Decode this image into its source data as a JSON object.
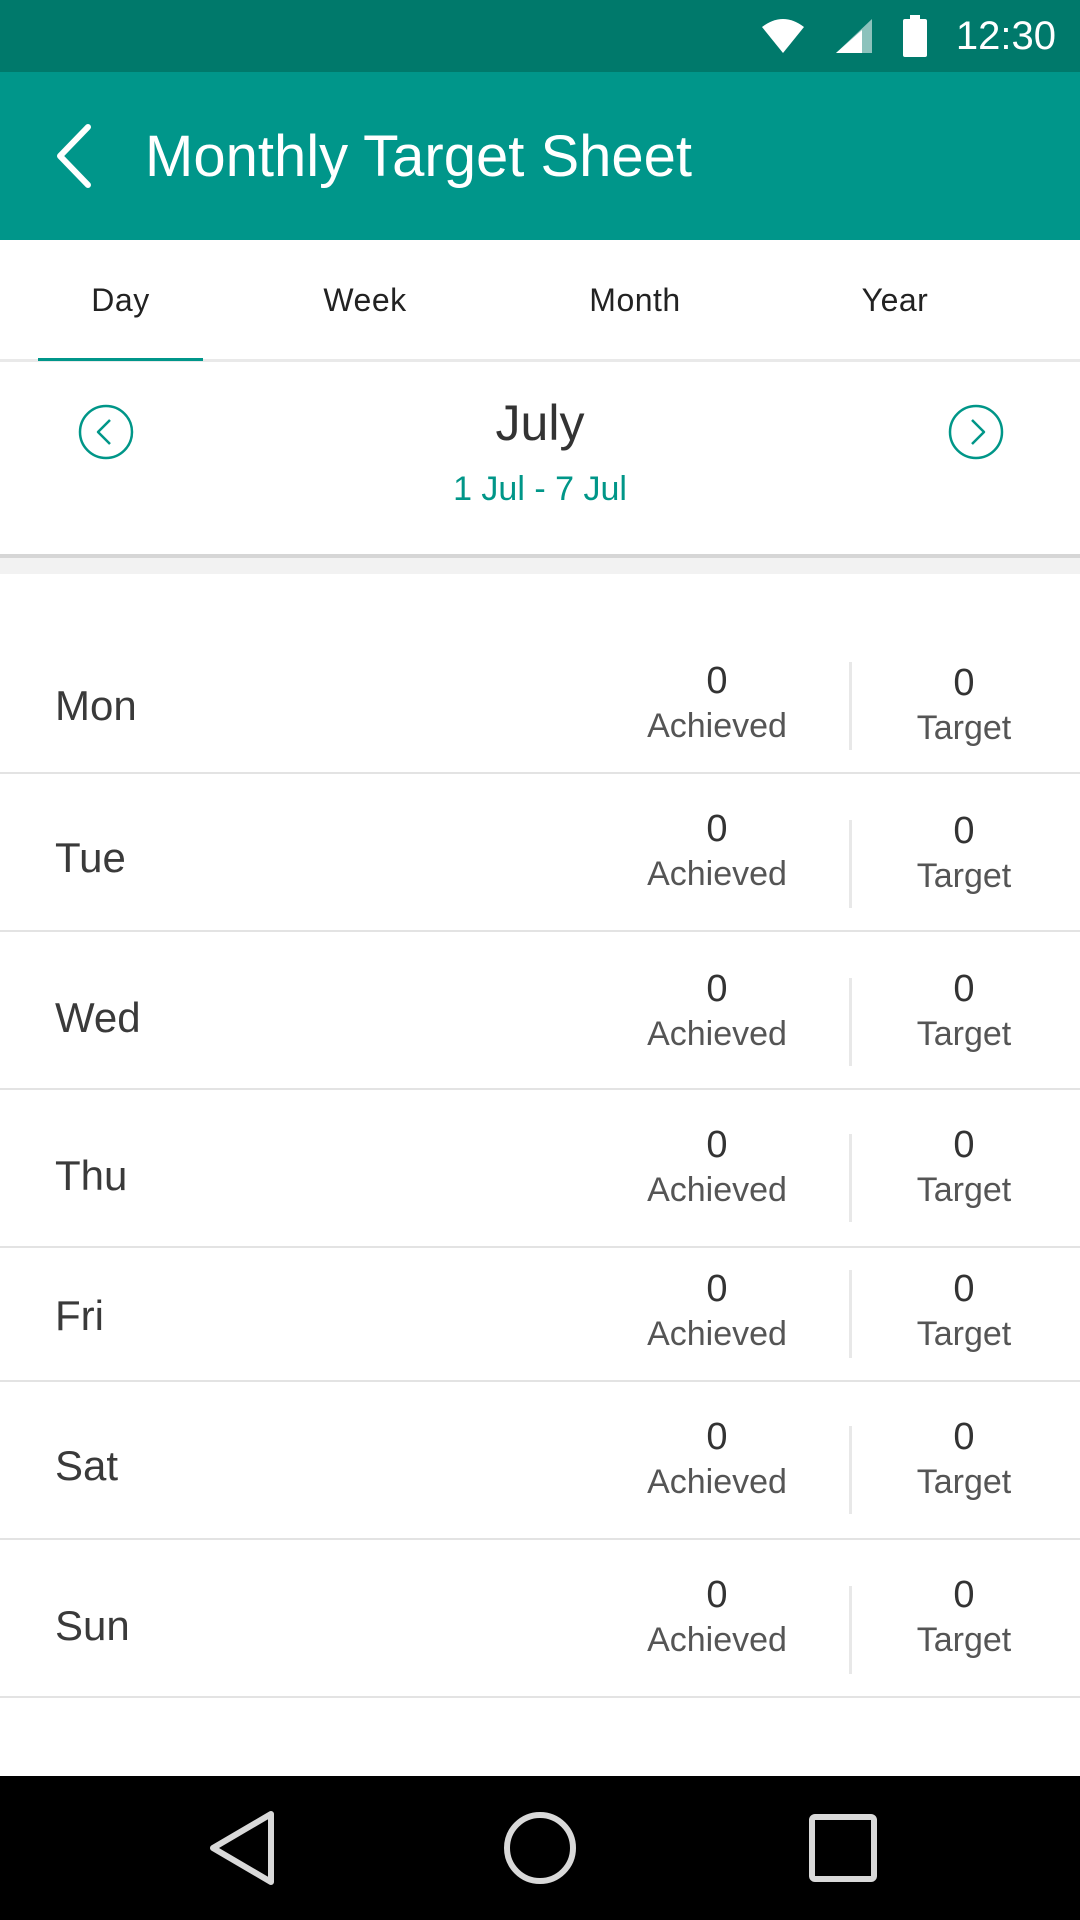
{
  "status_bar": {
    "time": "12:30",
    "icons": [
      "wifi-icon",
      "signal-icon",
      "battery-icon"
    ]
  },
  "app_bar": {
    "title": "Monthly Target Sheet",
    "back_icon": "chevron-left-icon"
  },
  "tabs": [
    {
      "label": "Day",
      "selected": true
    },
    {
      "label": "Week",
      "selected": false
    },
    {
      "label": "Month",
      "selected": false
    },
    {
      "label": "Year",
      "selected": false
    }
  ],
  "period": {
    "month": "July",
    "range": "1 Jul - 7 Jul",
    "prev_icon": "chevron-left-circle-icon",
    "next_icon": "chevron-right-circle-icon"
  },
  "days": [
    {
      "day": "Mon",
      "achieved": "0",
      "achieved_label": "Achieved",
      "target": "0",
      "target_label": "Target"
    },
    {
      "day": "Tue",
      "achieved": "0",
      "achieved_label": "Achieved",
      "target": "0",
      "target_label": "Target"
    },
    {
      "day": "Wed",
      "achieved": "0",
      "achieved_label": "Achieved",
      "target": "0",
      "target_label": "Target"
    },
    {
      "day": "Thu",
      "achieved": "0",
      "achieved_label": "Achieved",
      "target": "0",
      "target_label": "Target"
    },
    {
      "day": "Fri",
      "achieved": "0",
      "achieved_label": "Achieved",
      "target": "0",
      "target_label": "Target"
    },
    {
      "day": "Sat",
      "achieved": "0",
      "achieved_label": "Achieved",
      "target": "0",
      "target_label": "Target"
    },
    {
      "day": "Sun",
      "achieved": "0",
      "achieved_label": "Achieved",
      "target": "0",
      "target_label": "Target"
    }
  ],
  "nav_bar": {
    "icons": [
      "nav-back-icon",
      "nav-home-icon",
      "nav-recents-icon"
    ]
  },
  "colors": {
    "status_bar": "#00796b",
    "primary": "#00968a",
    "accent_text": "#009688"
  }
}
